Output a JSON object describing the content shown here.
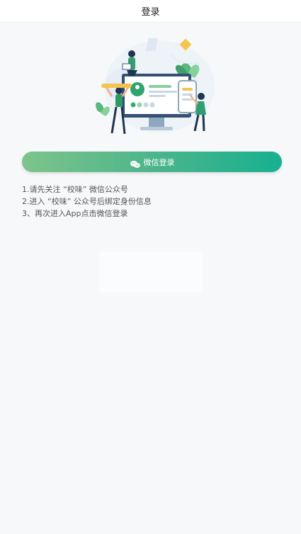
{
  "header": {
    "title": "登录"
  },
  "login_button": {
    "label": "微信登录",
    "icon": "wechat-icon",
    "gradient": [
      "#7dc48b",
      "#17b090"
    ]
  },
  "instructions": [
    "1.请先关注 “校味” 微信公众号",
    "2.进入 “校味” 公众号后绑定身份信息",
    "3、再次进入App点击微信登录"
  ],
  "colors": {
    "accent": "#17b090",
    "background": "#f7f8fa"
  }
}
